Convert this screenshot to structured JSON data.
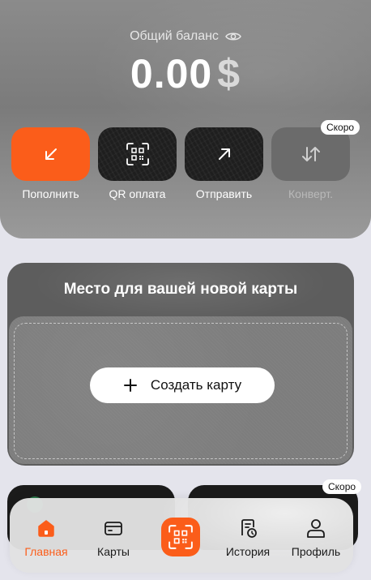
{
  "balance": {
    "label": "Общий баланс",
    "amount": "0.00",
    "currency": "$",
    "visibility_icon": "eye-icon"
  },
  "actions": [
    {
      "label": "Пополнить",
      "icon": "arrow-down-left-icon",
      "style": "orange"
    },
    {
      "label": "QR оплата",
      "icon": "qr-scan-icon",
      "style": "dark"
    },
    {
      "label": "Отправить",
      "icon": "arrow-up-right-icon",
      "style": "dark"
    },
    {
      "label": "Конверт.",
      "icon": "swap-vertical-icon",
      "style": "muted",
      "badge": "Скоро"
    }
  ],
  "new_card": {
    "title": "Место для вашей новой карты",
    "create_button_label": "Создать карту"
  },
  "peek_badge": "Скоро",
  "bottom_nav": {
    "items": [
      {
        "label": "Главная",
        "icon": "home-icon",
        "active": true
      },
      {
        "label": "Карты",
        "icon": "card-icon",
        "active": false
      },
      {
        "label": "",
        "icon": "qr-scan-icon",
        "active": false
      },
      {
        "label": "История",
        "icon": "history-icon",
        "active": false
      },
      {
        "label": "Профиль",
        "icon": "profile-icon",
        "active": false
      }
    ]
  },
  "colors": {
    "accent": "#fb5d1a",
    "background": "#e4e4ec"
  }
}
